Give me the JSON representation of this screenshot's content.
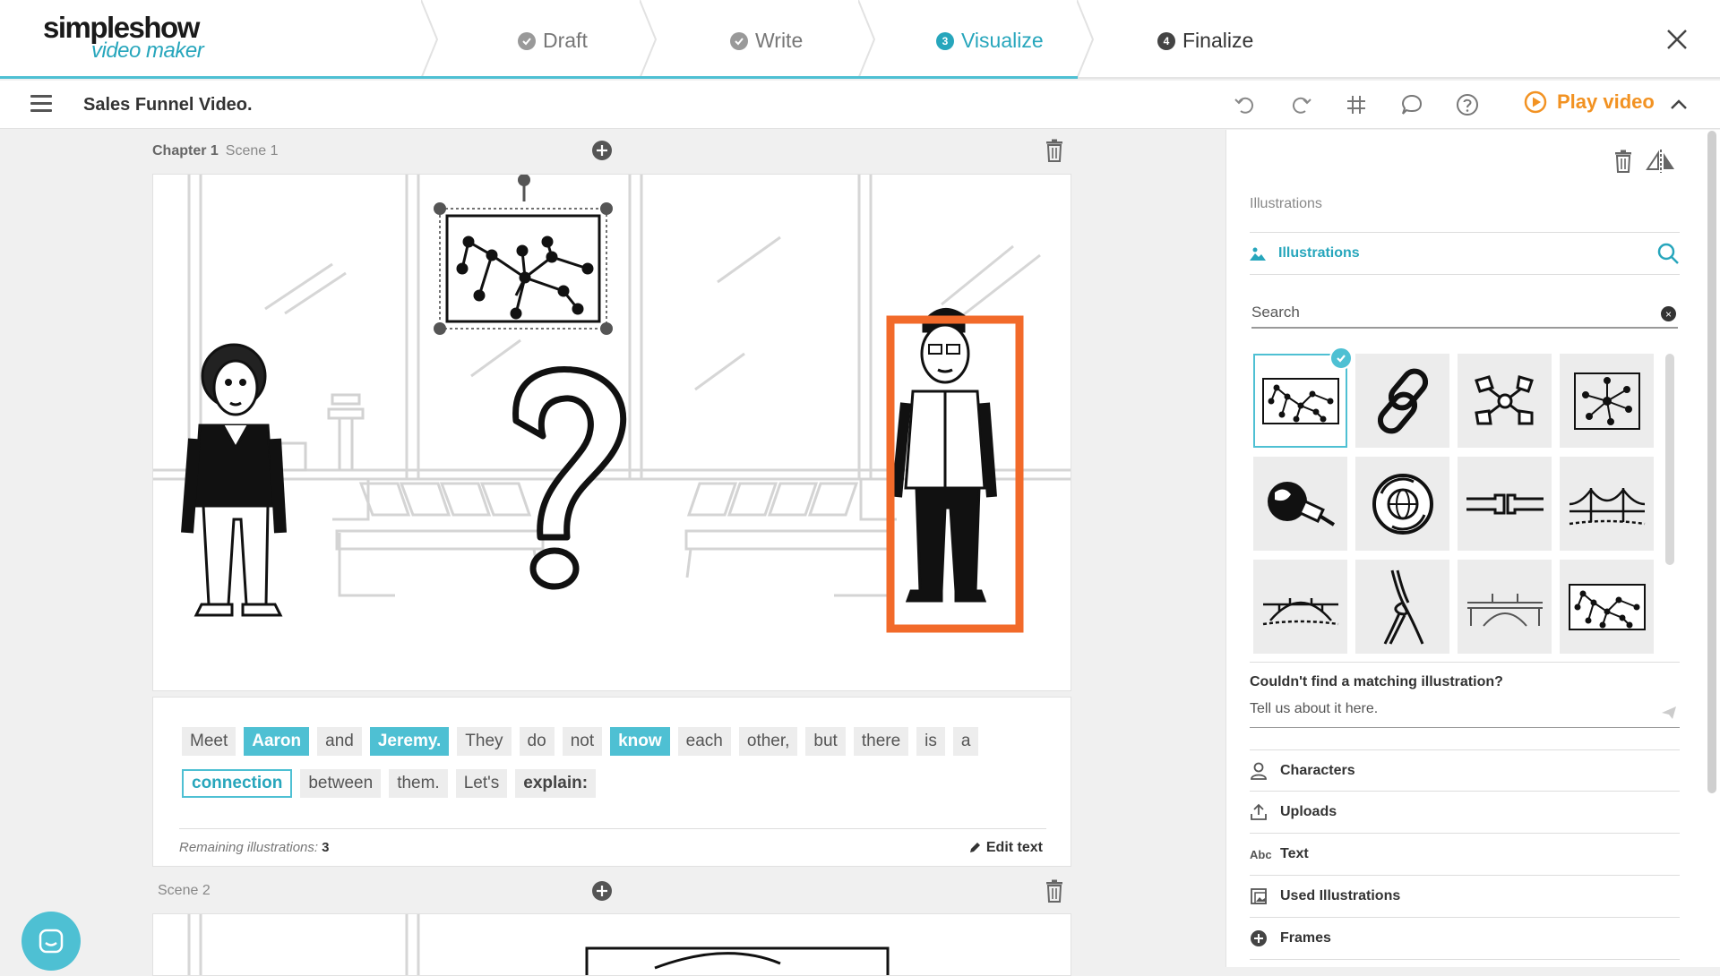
{
  "app": {
    "logo_line1": "simpleshow",
    "logo_line2": "video maker"
  },
  "steps": [
    {
      "num": "",
      "label": "Draft"
    },
    {
      "num": "",
      "label": "Write"
    },
    {
      "num": "3",
      "label": "Visualize"
    },
    {
      "num": "4",
      "label": "Finalize"
    }
  ],
  "toolbar": {
    "title": "Sales Funnel Video.",
    "play_label": "Play video"
  },
  "scene1": {
    "chapter_label": "Chapter 1",
    "scene_label": "Scene 1",
    "words": [
      {
        "text": "Meet",
        "style": "plain"
      },
      {
        "text": "Aaron",
        "style": "hl"
      },
      {
        "text": "and",
        "style": "plain"
      },
      {
        "text": "Jeremy.",
        "style": "hl"
      },
      {
        "text": "They",
        "style": "plain"
      },
      {
        "text": "do",
        "style": "plain"
      },
      {
        "text": "not",
        "style": "plain"
      },
      {
        "text": "know",
        "style": "hl"
      },
      {
        "text": "each",
        "style": "plain"
      },
      {
        "text": "other,",
        "style": "plain"
      },
      {
        "text": "but",
        "style": "plain"
      },
      {
        "text": "there",
        "style": "plain"
      },
      {
        "text": "is",
        "style": "plain"
      },
      {
        "text": "a",
        "style": "plain"
      },
      {
        "text": "connection",
        "style": "outline"
      },
      {
        "text": "between",
        "style": "plain"
      },
      {
        "text": "them.",
        "style": "plain"
      },
      {
        "text": "Let's",
        "style": "plain"
      },
      {
        "text": "explain:",
        "style": "bold"
      }
    ],
    "remaining_label": "Remaining illustrations:",
    "remaining_count": "3",
    "edit_text_label": "Edit text"
  },
  "scene2": {
    "scene_label": "Scene 2"
  },
  "sidebar": {
    "section_label": "Illustrations",
    "tab_label": "Illustrations",
    "search_placeholder": "Search",
    "tiles": [
      "network-icon",
      "chain-link-icon",
      "connected-nodes-icon",
      "network-hub-icon",
      "globe-plug-icon",
      "globe-rotate-icon",
      "cable-connector-icon",
      "bridge-icon",
      "arch-bridge-icon",
      "knotted-rope-icon",
      "stone-bridge-icon",
      "network-icon"
    ],
    "not_found_label": "Couldn't find a matching illustration?",
    "tell_placeholder": "Tell us about it here.",
    "menu": [
      {
        "label": "Characters",
        "icon": "person-icon"
      },
      {
        "label": "Uploads",
        "icon": "upload-icon"
      },
      {
        "label": "Text",
        "icon": "abc-icon",
        "icon_text": "Abc"
      },
      {
        "label": "Used Illustrations",
        "icon": "used-illustrations-icon"
      },
      {
        "label": "Frames",
        "icon": "plus-circle-icon"
      }
    ]
  },
  "colors": {
    "accent": "#4ec0d3",
    "play": "#f29222",
    "highlight_box": "#f26a2a"
  }
}
